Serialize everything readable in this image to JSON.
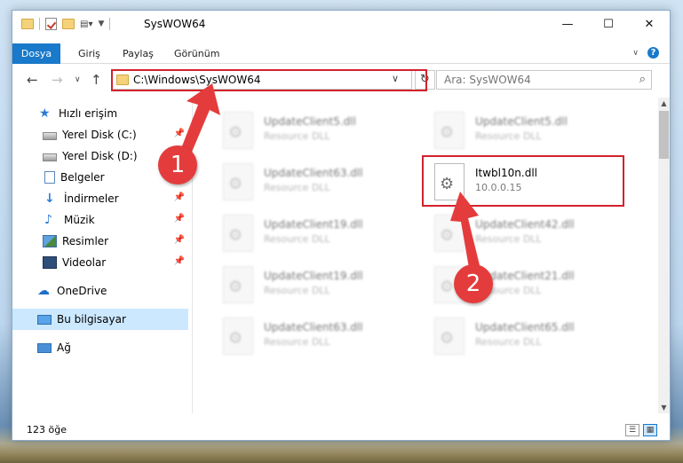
{
  "window": {
    "title": "SysWOW64"
  },
  "toolbar": {
    "window_controls": {
      "minimize": "—",
      "maximize": "☐",
      "close": "✕"
    }
  },
  "ribbon": {
    "tabs": [
      {
        "label": "Dosya",
        "active": true
      },
      {
        "label": "Giriş"
      },
      {
        "label": "Paylaş"
      },
      {
        "label": "Görünüm"
      }
    ]
  },
  "address": {
    "path": "C:\\Windows\\SysWOW64",
    "search_placeholder": "Ara: SysWOW64"
  },
  "sidebar": {
    "items": [
      {
        "label": "Hızlı erişim",
        "icon": "star-icon"
      },
      {
        "label": "Yerel Disk (C:)",
        "icon": "drive-icon",
        "pinned": true
      },
      {
        "label": "Yerel Disk (D:)",
        "icon": "drive-icon"
      },
      {
        "label": "Belgeler",
        "icon": "documents-icon"
      },
      {
        "label": "İndirmeler",
        "icon": "downloads-icon",
        "pinned": true
      },
      {
        "label": "Müzik",
        "icon": "music-icon",
        "pinned": true
      },
      {
        "label": "Resimler",
        "icon": "pictures-icon",
        "pinned": true
      },
      {
        "label": "Videolar",
        "icon": "videos-icon",
        "pinned": true
      },
      {
        "label": "OneDrive",
        "icon": "onedrive-icon"
      },
      {
        "label": "Bu bilgisayar",
        "icon": "this-pc-icon",
        "selected": true
      },
      {
        "label": "Ağ",
        "icon": "network-icon"
      }
    ]
  },
  "files": {
    "left": [
      {
        "name": "UpdateClient5.dll",
        "desc": "Resource DLL"
      },
      {
        "name": "UpdateClient63.dll",
        "desc": "Resource DLL"
      },
      {
        "name": "UpdateClient19.dll",
        "desc": "Resource DLL"
      },
      {
        "name": "UpdateClient19.dll",
        "desc": "Resource DLL"
      },
      {
        "name": "UpdateClient63.dll",
        "desc": "Resource DLL"
      }
    ],
    "right": [
      {
        "name": "UpdateClient5.dll",
        "desc": "Resource DLL"
      },
      {
        "name": "Itwbl10n.dll",
        "desc": "10.0.0.15",
        "highlighted": true
      },
      {
        "name": "UpdateClient42.dll",
        "desc": "Resource DLL"
      },
      {
        "name": "UpdateClient21.dll",
        "desc": "Resource DLL"
      },
      {
        "name": "UpdateClient65.dll",
        "desc": "Resource DLL"
      }
    ]
  },
  "status": {
    "item_count": "123 öğe"
  },
  "callouts": {
    "step1": "1",
    "step2": "2"
  },
  "colors": {
    "accent": "#1979ca",
    "highlight": "#d2222d",
    "selected_bg": "#cce8ff"
  }
}
